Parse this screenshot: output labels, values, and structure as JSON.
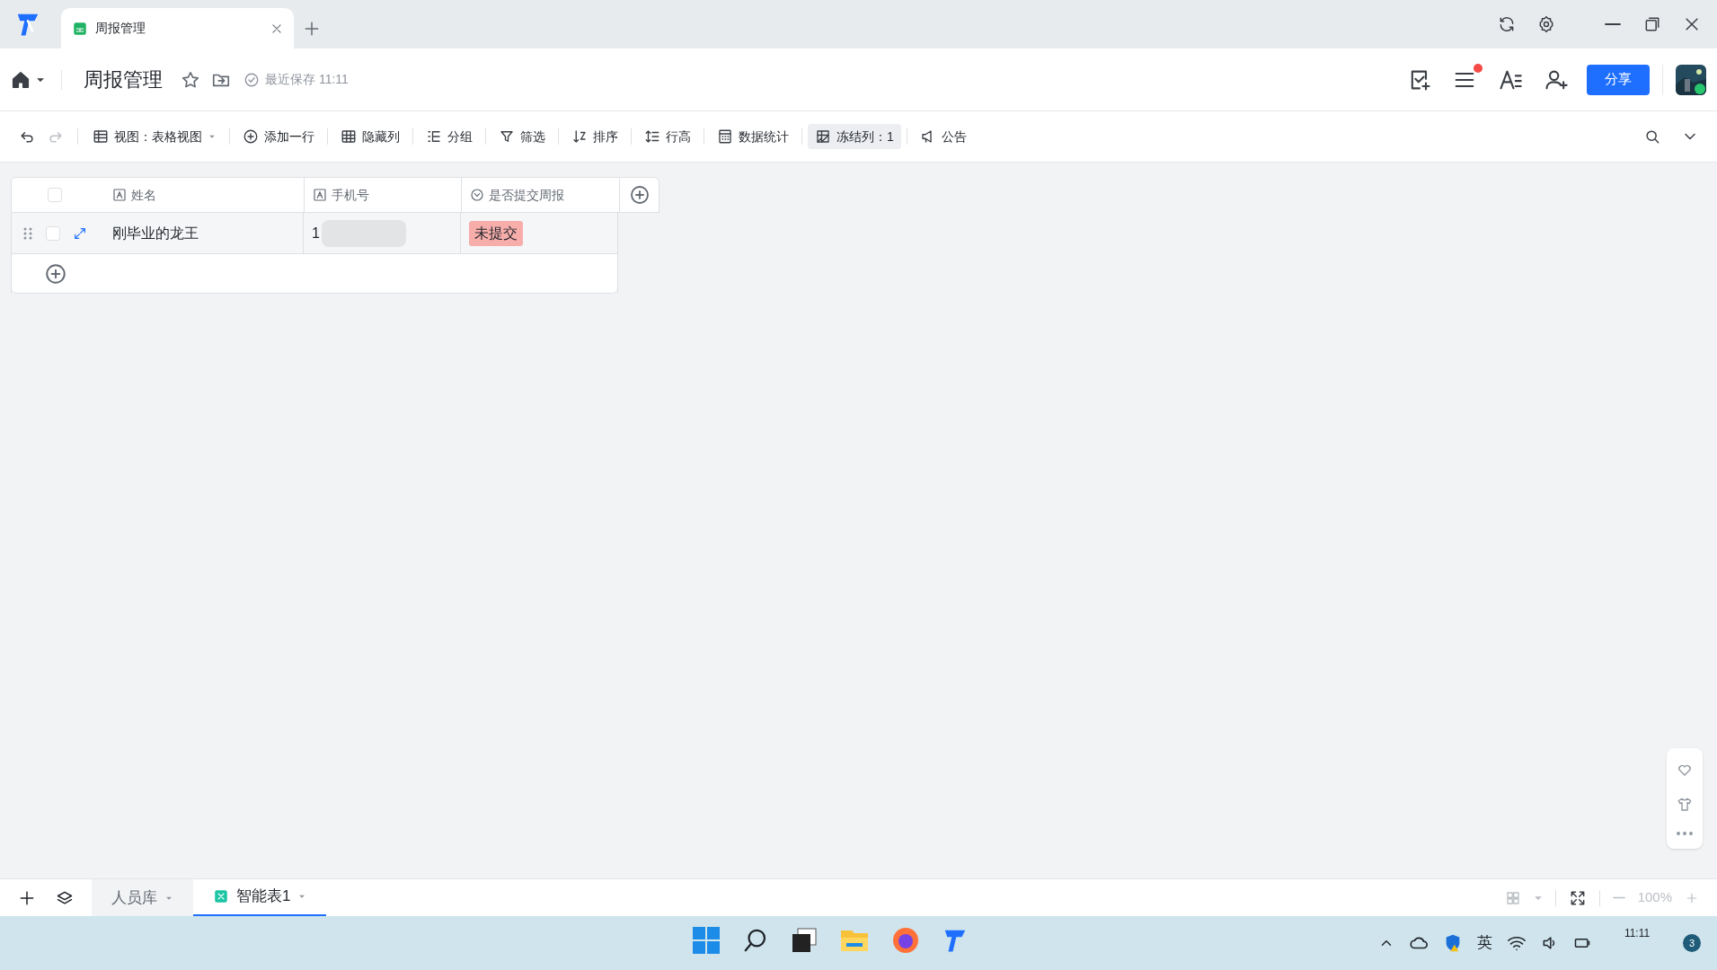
{
  "app_tabs": [
    {
      "label": "周报管理",
      "selected": true
    }
  ],
  "header": {
    "title": "周报管理",
    "save_status": "最近保存 11:11",
    "share_button": "分享",
    "notification_dot": true
  },
  "toolbar": [
    {
      "label": "视图：表格视图",
      "kind": "view",
      "active": false
    },
    {
      "label": "添加一行",
      "kind": "add",
      "active": false
    },
    {
      "label": "隐藏列",
      "kind": "hide",
      "active": false
    },
    {
      "label": "分组",
      "kind": "group",
      "active": false
    },
    {
      "label": "筛选",
      "kind": "filter",
      "active": false
    },
    {
      "label": "排序",
      "kind": "sort",
      "active": false
    },
    {
      "label": "行高",
      "kind": "height",
      "active": false
    },
    {
      "label": "数据统计",
      "kind": "stats",
      "active": false
    },
    {
      "label": "冻结列：1",
      "kind": "freeze",
      "active": true
    },
    {
      "label": "公告",
      "kind": "notice",
      "active": false
    }
  ],
  "table": {
    "all_checked": false,
    "columns": [
      {
        "label": "姓名",
        "kind": "text"
      },
      {
        "label": "手机号",
        "kind": "text"
      },
      {
        "label": "是否提交周报",
        "kind": "select"
      }
    ],
    "rows": [
      {
        "checked": false,
        "name": "刚毕业的龙王",
        "phone": "1",
        "status": "未提交"
      }
    ]
  },
  "sheet_tabs": [
    {
      "label": "人员库",
      "selected": false
    },
    {
      "label": "智能表1",
      "selected": true
    }
  ],
  "zoom": "100%",
  "taskbar": {
    "ime": "英",
    "time": "11:11",
    "badge": "3"
  }
}
